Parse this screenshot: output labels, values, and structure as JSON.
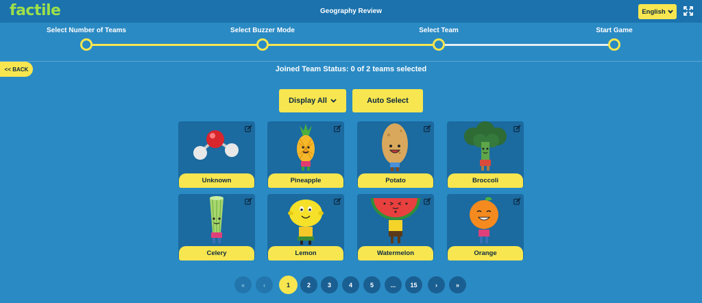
{
  "header": {
    "logo": "factile",
    "title": "Geography Review",
    "language": "English"
  },
  "steps": [
    {
      "label": "Select Number of Teams",
      "done": true
    },
    {
      "label": "Select Buzzer Mode",
      "done": true
    },
    {
      "label": "Select Team",
      "done": true
    },
    {
      "label": "Start Game",
      "done": false
    }
  ],
  "back_label": "<< BACK",
  "status_text": "Joined Team Status: 0 of 2 teams selected",
  "buttons": {
    "display_all": "Display All",
    "auto_select": "Auto Select"
  },
  "teams": [
    {
      "name": "Unknown",
      "icon": "molecule-icon"
    },
    {
      "name": "Pineapple",
      "icon": "pineapple-character-icon"
    },
    {
      "name": "Potato",
      "icon": "potato-character-icon"
    },
    {
      "name": "Broccoli",
      "icon": "broccoli-character-icon"
    },
    {
      "name": "Celery",
      "icon": "celery-character-icon"
    },
    {
      "name": "Lemon",
      "icon": "lemon-character-icon"
    },
    {
      "name": "Watermelon",
      "icon": "watermelon-character-icon"
    },
    {
      "name": "Orange",
      "icon": "orange-character-icon"
    }
  ],
  "pagination": {
    "first": "«",
    "prev": "‹",
    "pages": [
      "1",
      "2",
      "3",
      "4",
      "5",
      "...",
      "15"
    ],
    "current": "1",
    "next": "›",
    "last": "»"
  },
  "colors": {
    "background": "#2a8ac4",
    "topbar": "#1b72ad",
    "accent": "#f7e64f",
    "logo": "#9ee04a",
    "card": "#1b6aa0"
  }
}
